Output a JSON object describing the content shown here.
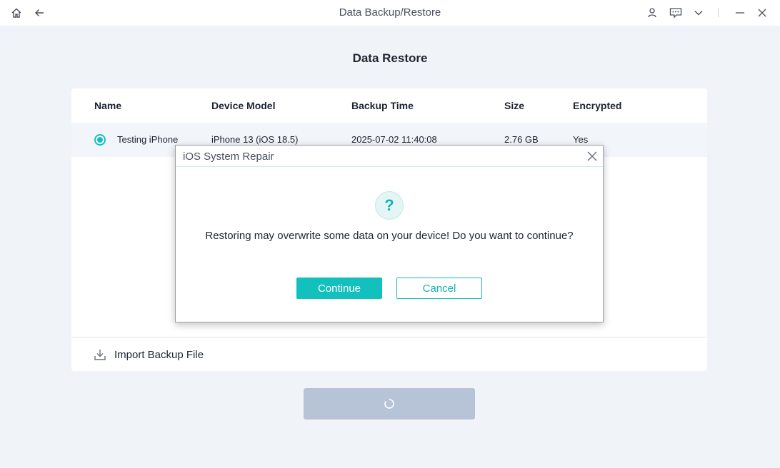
{
  "window": {
    "title": "Data Backup/Restore",
    "icons": [
      "home-icon",
      "back-arrow-icon",
      "user-icon",
      "feedback-icon",
      "chevron-down-icon",
      "minimize-icon",
      "close-icon"
    ]
  },
  "page": {
    "title": "Data Restore"
  },
  "table": {
    "columns": [
      "Name",
      "Device Model",
      "Backup Time",
      "Size",
      "Encrypted"
    ],
    "rows": [
      {
        "name": "Testing iPhone",
        "device_model": "iPhone 13 (iOS 18.5)",
        "backup_time": "2025-07-02 11:40:08",
        "size": "2.76 GB",
        "encrypted": "Yes",
        "selected": true
      }
    ]
  },
  "import": {
    "label": "Import Backup File"
  },
  "dialog": {
    "title": "iOS System Repair",
    "icon": "?",
    "message": "Restoring may overwrite some data on your device! Do you want to continue?",
    "continue_label": "Continue",
    "cancel_label": "Cancel"
  },
  "colors": {
    "accent": "#12c0be",
    "background": "#f0f3f7",
    "disabled_button": "#b7c4d8"
  }
}
